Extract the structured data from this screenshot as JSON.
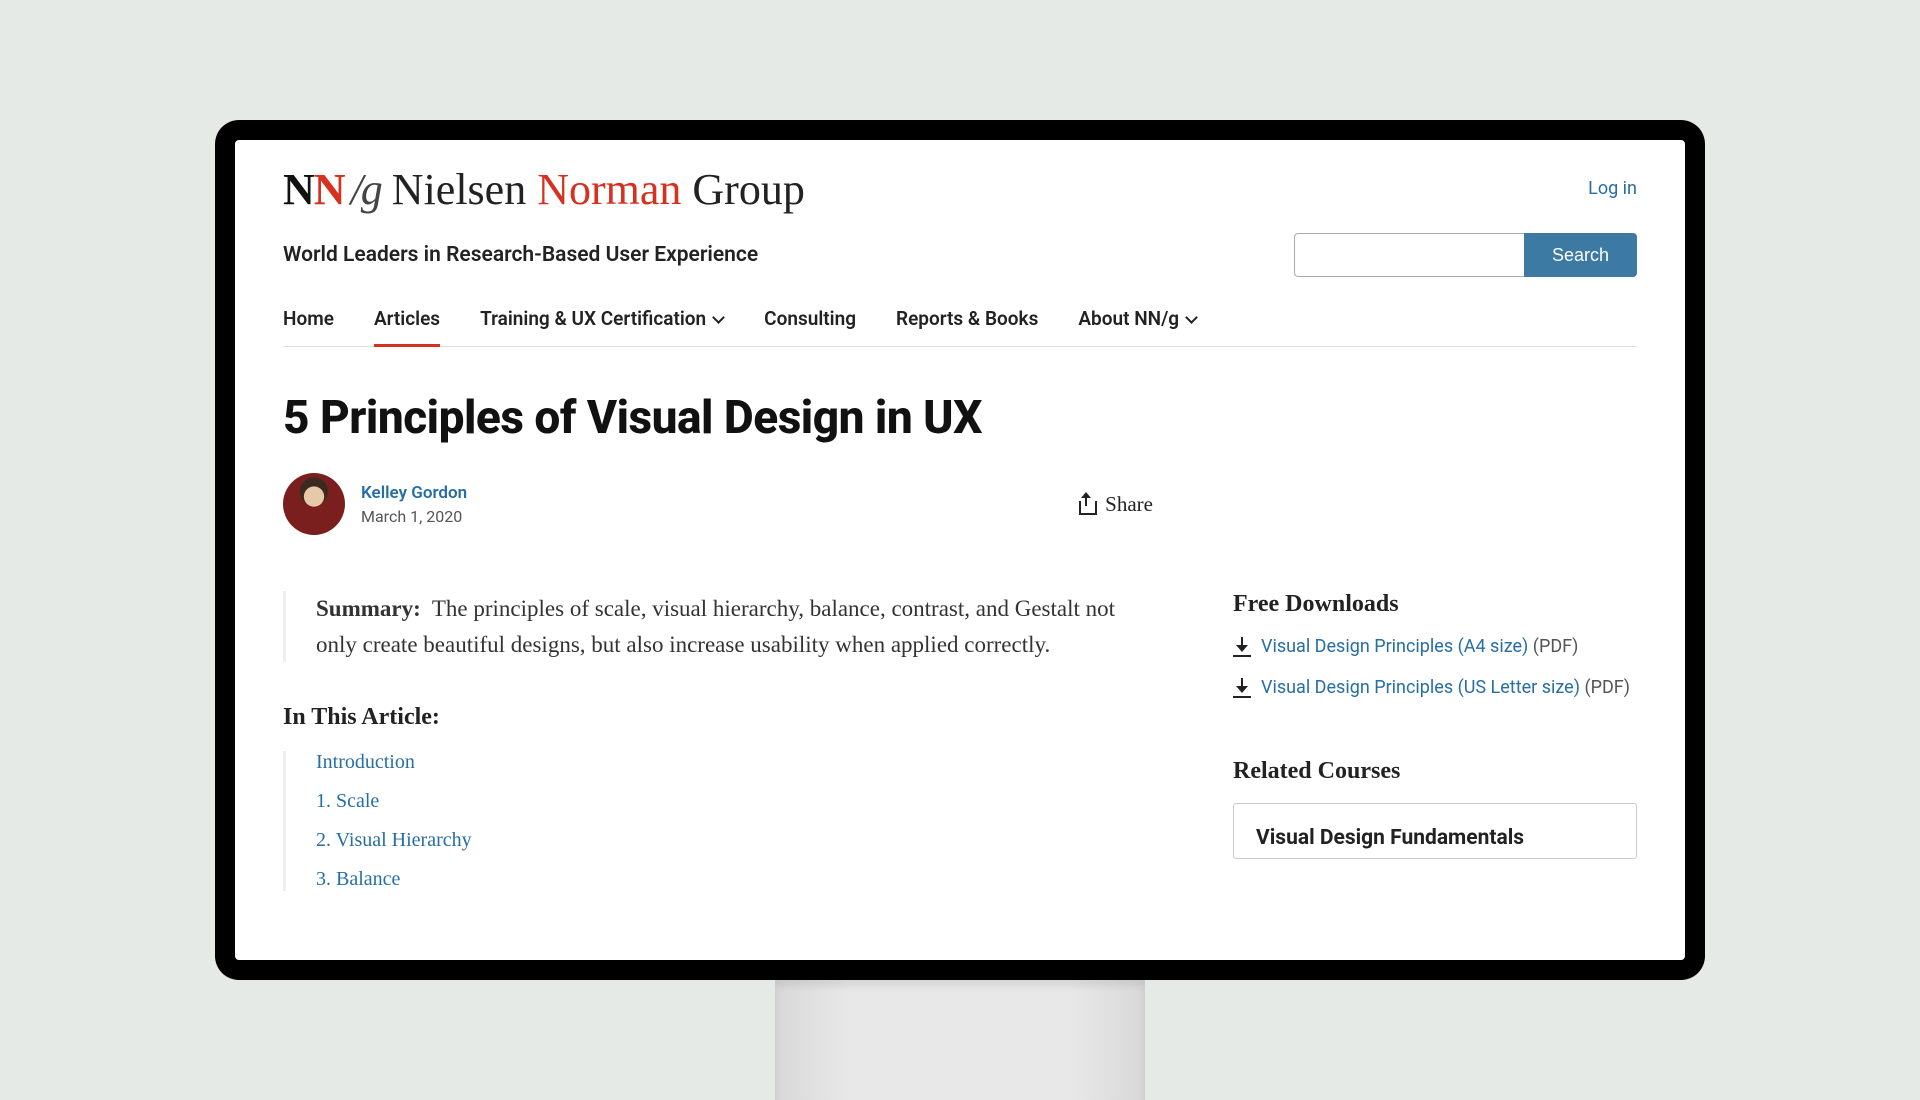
{
  "header": {
    "brand_nielsen": "Nielsen",
    "brand_norman": "Norman",
    "brand_group": "Group",
    "login": "Log in",
    "tagline": "World Leaders in Research-Based User Experience",
    "search_label": "Search"
  },
  "nav": [
    {
      "label": "Home",
      "dropdown": false,
      "active": false
    },
    {
      "label": "Articles",
      "dropdown": false,
      "active": true
    },
    {
      "label": "Training & UX Certification",
      "dropdown": true,
      "active": false
    },
    {
      "label": "Consulting",
      "dropdown": false,
      "active": false
    },
    {
      "label": "Reports & Books",
      "dropdown": false,
      "active": false
    },
    {
      "label": "About NN/g",
      "dropdown": true,
      "active": false
    }
  ],
  "article": {
    "title": "5 Principles of Visual Design in UX",
    "author": "Kelley Gordon",
    "date": "March 1, 2020",
    "share_label": "Share",
    "summary_label": "Summary:",
    "summary_text": "The principles of scale, visual hierarchy, balance, contrast, and Gestalt not only create beautiful designs, but also increase usability when applied correctly.",
    "toc_heading": "In This Article:",
    "toc": [
      "Introduction",
      "1. Scale",
      "2. Visual Hierarchy",
      "3. Balance"
    ]
  },
  "sidebar": {
    "downloads_heading": "Free Downloads",
    "downloads": [
      {
        "title": "Visual Design Principles (A4 size)",
        "suffix": "(PDF)"
      },
      {
        "title": "Visual Design Principles (US Letter size)",
        "suffix": "(PDF)"
      }
    ],
    "courses_heading": "Related Courses",
    "courses": [
      {
        "title": "Visual Design Fundamentals"
      }
    ]
  }
}
